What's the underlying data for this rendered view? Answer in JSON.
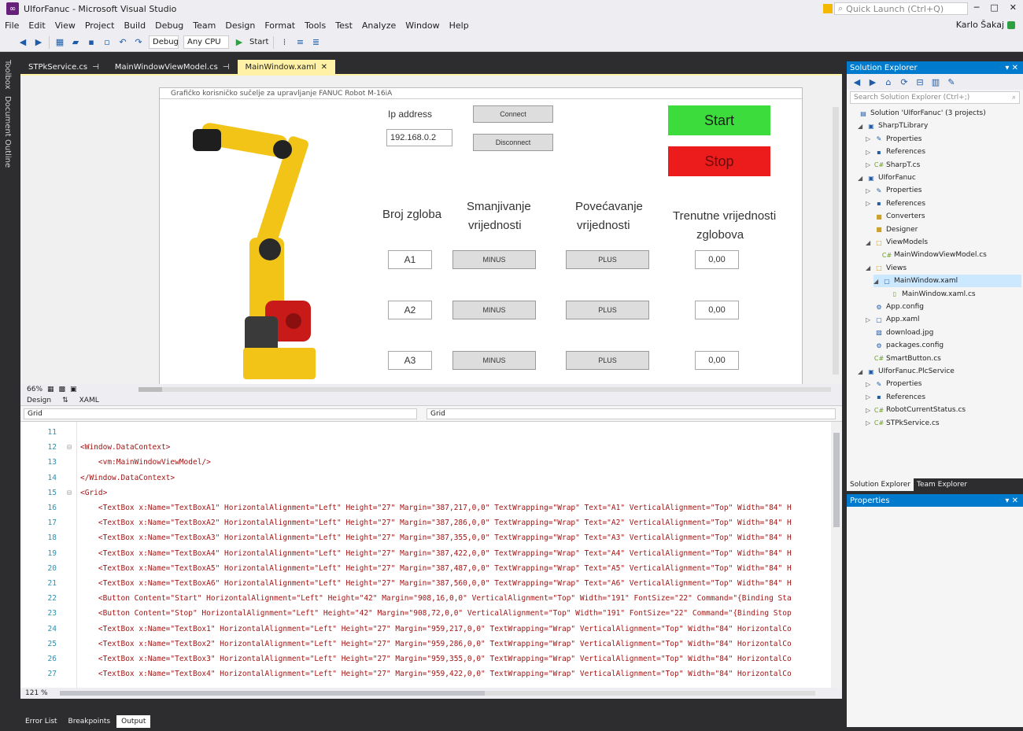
{
  "title_bar": {
    "title": "UIforFanuc - Microsoft Visual Studio",
    "quick_launch": "Quick Launch (Ctrl+Q)",
    "user": "Karlo Šakaj"
  },
  "menu": [
    "File",
    "Edit",
    "View",
    "Project",
    "Build",
    "Debug",
    "Team",
    "Design",
    "Format",
    "Tools",
    "Test",
    "Analyze",
    "Window",
    "Help"
  ],
  "toolbar": {
    "config": "Debug",
    "platform": "Any CPU",
    "start": "Start"
  },
  "side_tabs": [
    "Toolbox",
    "Document Outline"
  ],
  "doc_tabs": [
    {
      "label": "STPkService.cs"
    },
    {
      "label": "MainWindowViewModel.cs"
    },
    {
      "label": "MainWindow.xaml"
    }
  ],
  "window_title": "Grafičko korisničko sučelje za upravljanje FANUC Robot M-16iA",
  "form": {
    "ip_label": "Ip address",
    "ip_value": "192.168.0.2",
    "connect": "Connect",
    "disconnect": "Disconnect",
    "start": "Start",
    "stop": "Stop",
    "col_joint": "Broj zgloba",
    "col_minus_l1": "Smanjivanje",
    "col_minus_l2": "vrijednosti",
    "col_plus_l1": "Povećavanje",
    "col_plus_l2": "vrijednosti",
    "col_current_l1": "Trenutne vrijednosti",
    "col_current_l2": "zglobova",
    "rows": [
      {
        "joint": "A1",
        "minus": "MINUS",
        "plus": "PLUS",
        "value": "0,00"
      },
      {
        "joint": "A2",
        "minus": "MINUS",
        "plus": "PLUS",
        "value": "0,00"
      },
      {
        "joint": "A3",
        "minus": "MINUS",
        "plus": "PLUS",
        "value": "0,00"
      }
    ]
  },
  "designer": {
    "zoom": "66%",
    "tab_design": "Design",
    "tab_xaml": "XAML",
    "nav_left": "Grid",
    "nav_right": "Grid"
  },
  "editor": {
    "zoom": "121 %",
    "lines": [
      {
        "n": "11",
        "fold": "",
        "code": ""
      },
      {
        "n": "12",
        "fold": "⊟",
        "code": "<Window.DataContext>"
      },
      {
        "n": "13",
        "fold": "",
        "code": "    <vm:MainWindowViewModel/>"
      },
      {
        "n": "14",
        "fold": "",
        "code": "</Window.DataContext>"
      },
      {
        "n": "15",
        "fold": "⊟",
        "code": "<Grid>"
      },
      {
        "n": "16",
        "fold": "",
        "code": "    <TextBox x:Name=\"TextBoxA1\" HorizontalAlignment=\"Left\" Height=\"27\" Margin=\"387,217,0,0\" TextWrapping=\"Wrap\" Text=\"A1\" VerticalAlignment=\"Top\" Width=\"84\" H"
      },
      {
        "n": "17",
        "fold": "",
        "code": "    <TextBox x:Name=\"TextBoxA2\" HorizontalAlignment=\"Left\" Height=\"27\" Margin=\"387,286,0,0\" TextWrapping=\"Wrap\" Text=\"A2\" VerticalAlignment=\"Top\" Width=\"84\" H"
      },
      {
        "n": "18",
        "fold": "",
        "code": "    <TextBox x:Name=\"TextBoxA3\" HorizontalAlignment=\"Left\" Height=\"27\" Margin=\"387,355,0,0\" TextWrapping=\"Wrap\" Text=\"A3\" VerticalAlignment=\"Top\" Width=\"84\" H"
      },
      {
        "n": "19",
        "fold": "",
        "code": "    <TextBox x:Name=\"TextBoxA4\" HorizontalAlignment=\"Left\" Height=\"27\" Margin=\"387,422,0,0\" TextWrapping=\"Wrap\" Text=\"A4\" VerticalAlignment=\"Top\" Width=\"84\" H"
      },
      {
        "n": "20",
        "fold": "",
        "code": "    <TextBox x:Name=\"TextBoxA5\" HorizontalAlignment=\"Left\" Height=\"27\" Margin=\"387,487,0,0\" TextWrapping=\"Wrap\" Text=\"A5\" VerticalAlignment=\"Top\" Width=\"84\" H"
      },
      {
        "n": "21",
        "fold": "",
        "code": "    <TextBox x:Name=\"TextBoxA6\" HorizontalAlignment=\"Left\" Height=\"27\" Margin=\"387,560,0,0\" TextWrapping=\"Wrap\" Text=\"A6\" VerticalAlignment=\"Top\" Width=\"84\" H"
      },
      {
        "n": "22",
        "fold": "",
        "code": "    <Button Content=\"Start\" HorizontalAlignment=\"Left\" Height=\"42\" Margin=\"908,16,0,0\" VerticalAlignment=\"Top\" Width=\"191\" FontSize=\"22\" Command=\"{Binding Sta"
      },
      {
        "n": "23",
        "fold": "",
        "code": "    <Button Content=\"Stop\" HorizontalAlignment=\"Left\" Height=\"42\" Margin=\"908,72,0,0\" VerticalAlignment=\"Top\" Width=\"191\" FontSize=\"22\" Command=\"{Binding Stop"
      },
      {
        "n": "24",
        "fold": "",
        "code": "    <TextBox x:Name=\"TextBox1\" HorizontalAlignment=\"Left\" Height=\"27\" Margin=\"959,217,0,0\" TextWrapping=\"Wrap\" VerticalAlignment=\"Top\" Width=\"84\" HorizontalCo"
      },
      {
        "n": "25",
        "fold": "",
        "code": "    <TextBox x:Name=\"TextBox2\" HorizontalAlignment=\"Left\" Height=\"27\" Margin=\"959,286,0,0\" TextWrapping=\"Wrap\" VerticalAlignment=\"Top\" Width=\"84\" HorizontalCo"
      },
      {
        "n": "26",
        "fold": "",
        "code": "    <TextBox x:Name=\"TextBox3\" HorizontalAlignment=\"Left\" Height=\"27\" Margin=\"959,355,0,0\" TextWrapping=\"Wrap\" VerticalAlignment=\"Top\" Width=\"84\" HorizontalCo"
      },
      {
        "n": "27",
        "fold": "",
        "code": "    <TextBox x:Name=\"TextBox4\" HorizontalAlignment=\"Left\" Height=\"27\" Margin=\"959,422,0,0\" TextWrapping=\"Wrap\" VerticalAlignment=\"Top\" Width=\"84\" HorizontalCo"
      }
    ]
  },
  "bottom_tabs": [
    "Error List",
    "Breakpoints",
    "Output"
  ],
  "solution_explorer": {
    "title": "Solution Explorer",
    "search": "Search Solution Explorer (Ctrl+;)",
    "tree": [
      {
        "label": "Solution 'UIforFanuc' (3 projects)",
        "icon": "solution-icon",
        "glyph": "▤",
        "expand": "",
        "indent": 0
      },
      {
        "label": "SharpTLibrary",
        "icon": "csproj-icon",
        "glyph": "▣",
        "expand": "◢",
        "indent": 1
      },
      {
        "label": "Properties",
        "icon": "wrench-icon",
        "glyph": "✎",
        "expand": "▷",
        "indent": 2
      },
      {
        "label": "References",
        "icon": "references-icon",
        "glyph": "▪",
        "expand": "▷",
        "indent": 2
      },
      {
        "label": "SharpT.cs",
        "icon": "cs-file-icon",
        "glyph": "C#",
        "expand": "▷",
        "indent": 2
      },
      {
        "label": "UIforFanuc",
        "icon": "csproj-icon",
        "glyph": "▣",
        "expand": "◢",
        "indent": 1
      },
      {
        "label": "Properties",
        "icon": "wrench-icon",
        "glyph": "✎",
        "expand": "▷",
        "indent": 2
      },
      {
        "label": "References",
        "icon": "references-icon",
        "glyph": "▪",
        "expand": "▷",
        "indent": 2
      },
      {
        "label": "Converters",
        "icon": "folder-icon",
        "glyph": "■",
        "expand": "",
        "indent": 2
      },
      {
        "label": "Designer",
        "icon": "folder-icon",
        "glyph": "■",
        "expand": "",
        "indent": 2
      },
      {
        "label": "ViewModels",
        "icon": "folder-icon",
        "glyph": "□",
        "expand": "◢",
        "indent": 2
      },
      {
        "label": "MainWindowViewModel.cs",
        "icon": "cs-file-icon",
        "glyph": "C#",
        "expand": "",
        "indent": 3
      },
      {
        "label": "Views",
        "icon": "folder-icon",
        "glyph": "□",
        "expand": "◢",
        "indent": 2
      },
      {
        "label": "MainWindow.xaml",
        "icon": "xaml-file-icon",
        "glyph": "▢",
        "expand": "◢",
        "indent": 3,
        "selected": true
      },
      {
        "label": "MainWindow.xaml.cs",
        "icon": "cs-file-icon",
        "glyph": "▯",
        "expand": "",
        "indent": 4
      },
      {
        "label": "App.config",
        "icon": "config-icon",
        "glyph": "⚙",
        "expand": "",
        "indent": 2
      },
      {
        "label": "App.xaml",
        "icon": "xaml-file-icon",
        "glyph": "▢",
        "expand": "▷",
        "indent": 2
      },
      {
        "label": "download.jpg",
        "icon": "image-file-icon",
        "glyph": "▨",
        "expand": "",
        "indent": 2
      },
      {
        "label": "packages.config",
        "icon": "config-icon",
        "glyph": "⚙",
        "expand": "",
        "indent": 2
      },
      {
        "label": "SmartButton.cs",
        "icon": "cs-file-icon",
        "glyph": "C#",
        "expand": "",
        "indent": 2
      },
      {
        "label": "UIforFanuc.PlcService",
        "icon": "csproj-icon",
        "glyph": "▣",
        "expand": "◢",
        "indent": 1
      },
      {
        "label": "Properties",
        "icon": "wrench-icon",
        "glyph": "✎",
        "expand": "▷",
        "indent": 2
      },
      {
        "label": "References",
        "icon": "references-icon",
        "glyph": "▪",
        "expand": "▷",
        "indent": 2
      },
      {
        "label": "RobotCurrentStatus.cs",
        "icon": "cs-file-icon",
        "glyph": "C#",
        "expand": "▷",
        "indent": 2
      },
      {
        "label": "STPkService.cs",
        "icon": "cs-file-icon",
        "glyph": "C#",
        "expand": "▷",
        "indent": 2
      }
    ],
    "bottom_tabs": [
      "Solution Explorer",
      "Team Explorer"
    ]
  },
  "properties": {
    "title": "Properties"
  },
  "colors": {
    "accent": "#007acc",
    "start": "#3cdc3c",
    "stop": "#ed1c1c",
    "robot": "#f2c418",
    "tab_active": "#fff1a6"
  }
}
